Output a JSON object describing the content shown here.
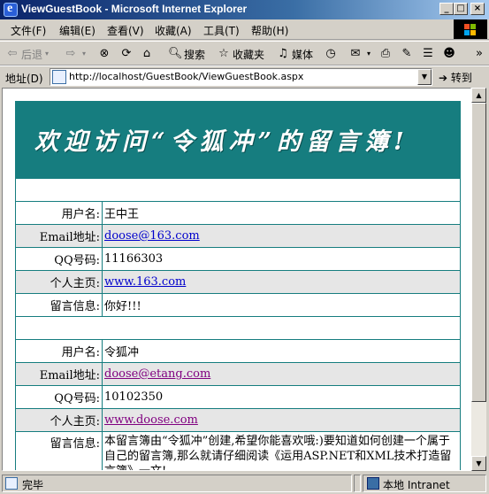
{
  "window": {
    "title": "ViewGuestBook - Microsoft Internet Explorer",
    "minimize": "_",
    "maximize": "□",
    "close": "×"
  },
  "menu": {
    "items": [
      "文件(F)",
      "编辑(E)",
      "查看(V)",
      "收藏(A)",
      "工具(T)",
      "帮助(H)"
    ]
  },
  "toolbar": {
    "back": "后退",
    "search": "搜索",
    "favorites": "收藏夹",
    "media": "媒体"
  },
  "address": {
    "label": "地址(D)",
    "url": "http://localhost/GuestBook/ViewGuestBook.aspx",
    "go": "转到"
  },
  "page": {
    "heading": "欢迎访问“令狐冲”的留言簿!",
    "colors": {
      "banner": "#167d7f",
      "border": "#167d7f",
      "alt_row": "#e6e6e6"
    },
    "entries": [
      {
        "username_label": "用户名:",
        "username": "王中王",
        "email_label": "Email地址:",
        "email": "doose@163.com",
        "qq_label": "QQ号码:",
        "qq": "11166303",
        "homepage_label": "个人主页:",
        "homepage": "www.163.com",
        "message_label": "留言信息:",
        "message": "你好!!!"
      },
      {
        "username_label": "用户名:",
        "username": "令狐冲",
        "email_label": "Email地址:",
        "email": "doose@etang.com",
        "qq_label": "QQ号码:",
        "qq": "10102350",
        "homepage_label": "个人主页:",
        "homepage": "www.doose.com",
        "message_label": "留言信息:",
        "message": "本留言簿由“令狐冲”创建,希望你能喜欢哦:)要知道如何创建一个属于自己的留言簿,那么就请仔细阅读《运用ASP.NET和XML技术打造留言簿》一文!"
      }
    ]
  },
  "status": {
    "left": "完毕",
    "zone": "本地 Intranet"
  }
}
